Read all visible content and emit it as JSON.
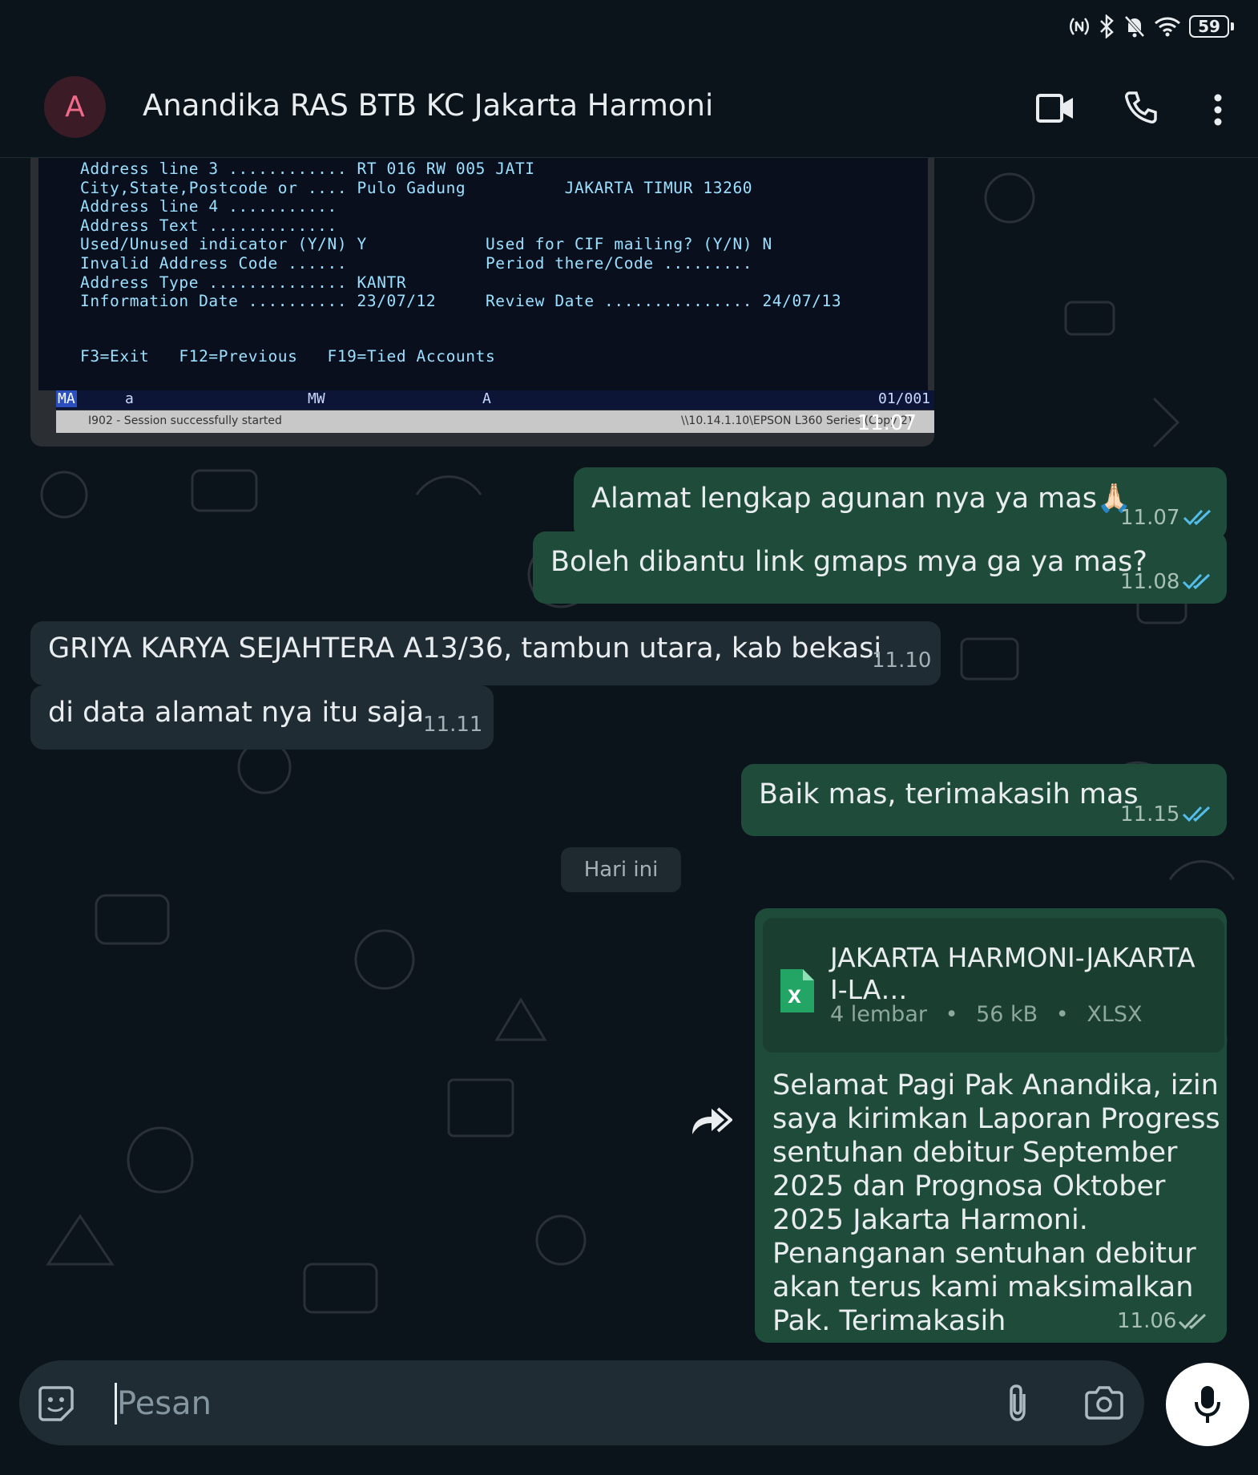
{
  "status_bar": {
    "battery": "59"
  },
  "header": {
    "avatar_letter": "A",
    "title": "Anandika RAS BTB KC Jakarta Harmoni"
  },
  "image_message": {
    "terminal_lines": [
      "Address line 3 ............ RT 016 RW 005 JATI",
      "City,State,Postcode or .... Pulo Gadung          JAKARTA TIMUR 13260",
      "Address line 4 ...........",
      "Address Text .............",
      "Used/Unused indicator (Y/N) Y            Used for CIF mailing? (Y/N) N",
      "Invalid Address Code ......              Period there/Code .........",
      "Address Type .............. KANTR",
      "Information Date .......... 23/07/12     Review Date ............... 24/07/13"
    ],
    "function_keys": "F3=Exit   F12=Previous   F19=Tied Accounts",
    "status_ma": "MA",
    "status_a": "a",
    "status_mw": "MW",
    "status_a2": "A",
    "status_page": "01/001",
    "session_text": "I902 - Session successfully started",
    "printer_text": "\\\\10.14.1.10\\EPSON L360 Series (Copy 2)",
    "time": "11.07"
  },
  "messages": [
    {
      "text": "Alamat lengkap agunan nya ya mas🙏🏻",
      "time": "11.07"
    },
    {
      "text": "Boleh dibantu link gmaps mya ga ya mas?",
      "time": "11.08"
    },
    {
      "text": "GRIYA KARYA SEJAHTERA A13/36, tambun utara, kab bekasi",
      "time": "11.10"
    },
    {
      "text": "di data alamat nya itu saja",
      "time": "11.11"
    },
    {
      "text": "Baik mas, terimakasih mas",
      "time": "11.15"
    }
  ],
  "day_divider": "Hari ini",
  "document_message": {
    "file_name": "JAKARTA HARMONI-JAKARTA I-LA…",
    "pages": "4 lembar",
    "size": "56 kB",
    "type": "XLSX",
    "separator": "•",
    "caption": "Selamat Pagi Pak Anandika, izin saya kirimkan Laporan Progress sentuhan debitur September 2025 dan Prognosa Oktober 2025 Jakarta Harmoni. Penanganan sentuhan debitur akan terus kami maksimalkan Pak. Terimakasih",
    "time": "11.06"
  },
  "input": {
    "placeholder": "Pesan"
  },
  "icons": {
    "emoji": "sticker-icon",
    "attach": "paperclip-icon",
    "camera": "camera-icon",
    "mic": "mic-icon",
    "video": "video-call-icon",
    "call": "phone-icon",
    "menu": "more-vert-icon",
    "forward": "forward-icon"
  },
  "colors": {
    "outgoing": "#1f4c3a",
    "incoming": "#202c33",
    "tick": "#53bdeb",
    "background": "#0b141a"
  }
}
